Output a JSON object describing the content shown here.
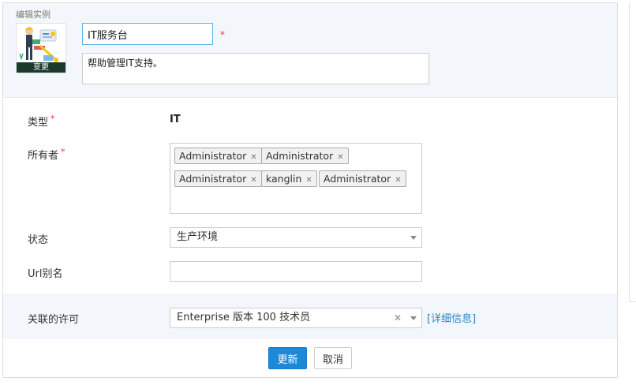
{
  "header": {
    "title": "编辑实例",
    "avatar_change_label": "变更",
    "name_value": "IT服务台",
    "description_value": "帮助管理IT支持。"
  },
  "form": {
    "required_mark": "*",
    "type_label": "类型",
    "type_value": "IT",
    "owners_label": "所有者",
    "owners": [
      "Administrator",
      "Administrator",
      "Administrator",
      "kanglin",
      "Administrator"
    ],
    "tag_remove_glyph": "✕",
    "status_label": "状态",
    "status_value": "生产环境",
    "url_label": "Url别名",
    "url_value": "",
    "license_label": "关联的许可",
    "license_value": "Enterprise 版本 100 技术员",
    "license_clear_glyph": "✕",
    "license_detail_link": "[详细信息]"
  },
  "actions": {
    "update_label": "更新",
    "cancel_label": "取消"
  },
  "colors": {
    "accent": "#1e88d8",
    "required": "#e03c3c",
    "link": "#2a86c8",
    "header_bg": "#f3f7fb"
  },
  "icons": {
    "avatar": "it-helpdesk-illustration",
    "select_caret": "caret-down-icon",
    "tag_remove": "close-icon"
  }
}
